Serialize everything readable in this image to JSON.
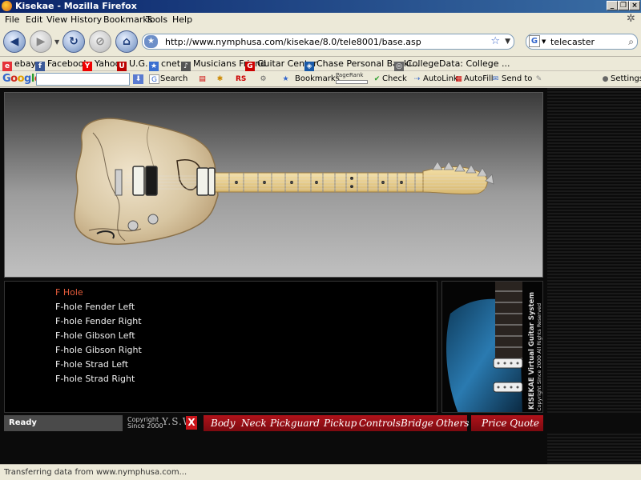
{
  "window": {
    "title": "Kisekae - Mozilla Firefox"
  },
  "menubar": {
    "items": [
      "File",
      "Edit",
      "View",
      "History",
      "Bookmarks",
      "Tools",
      "Help"
    ]
  },
  "nav": {
    "url": "http://www.nymphusa.com/kisekae/8.0/tele8001/base.asp",
    "search_value": "telecaster"
  },
  "bookmarks": [
    "ebay",
    "Facebook",
    "Yahoo",
    "U.G.",
    "cnet",
    "Musicians Friend",
    "Guitar Center",
    "Chase Personal Banki...",
    "CollegeData: College ..."
  ],
  "googlebar": {
    "logo": "Google",
    "search_label": "Search",
    "bookmarks_label": "Bookmarks",
    "pagerank_label": "PageRank",
    "check_label": "Check",
    "autolink_label": "AutoLink",
    "autofill_label": "AutoFill",
    "sendto_label": "Send to",
    "settings_label": "Settings"
  },
  "options": {
    "items": [
      "F Hole",
      "F-hole Fender Left",
      "F-hole Fender Right",
      "F-hole Gibson Left",
      "F-hole Gibson Right",
      "F-hole Strad Left",
      "F-hole Strad Right"
    ],
    "active_index": 0
  },
  "ad": {
    "line1": "KISEKAE Virtual Guitar System",
    "line2": "Copyright Since 2000 All Rights Reserved"
  },
  "footer": {
    "status": "Ready",
    "copyright_line1": "Copyright",
    "copyright_line2": "Since 2000",
    "brand": "Y.S.W",
    "x_label": "X",
    "menu": [
      "Body",
      "Neck",
      "Pickguard",
      "Pickup",
      "Controls",
      "Bridge",
      "Others"
    ],
    "price_quote": "Price Quote"
  },
  "statusbar": {
    "text": "Transferring data from www.nymphusa.com..."
  },
  "colors": {
    "active_option": "#e05a3a",
    "menu_red": "#b0121a",
    "titlebar": "#0a246a"
  }
}
